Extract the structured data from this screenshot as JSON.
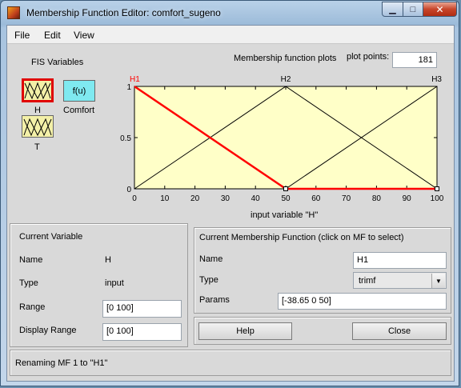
{
  "window": {
    "title": "Membership Function Editor: comfort_sugeno",
    "minimize_glyph": "▁",
    "maximize_glyph": "□",
    "close_glyph": "✕"
  },
  "menu": [
    "File",
    "Edit",
    "View"
  ],
  "fis_variables": {
    "title": "FIS Variables",
    "inputs": [
      {
        "name": "H",
        "selected": true
      },
      {
        "name": "T",
        "selected": false
      }
    ],
    "output": {
      "symbol": "f(u)",
      "name": "Comfort"
    }
  },
  "plot": {
    "title": "Membership function plots",
    "plot_points_label": "plot points:",
    "plot_points_value": "181",
    "xlabel": "input variable \"H\"",
    "chart_data": {
      "type": "line",
      "xlim": [
        0,
        100
      ],
      "ylim": [
        0,
        1
      ],
      "x_ticks": [
        "0",
        "10",
        "20",
        "30",
        "40",
        "50",
        "60",
        "70",
        "80",
        "90",
        "100"
      ],
      "y_ticks": [
        "0",
        "0.5",
        "1"
      ],
      "series": [
        {
          "name": "H1",
          "x": [
            0,
            50,
            100
          ],
          "y": [
            1,
            0,
            0
          ],
          "color": "#ff0000",
          "selected": true
        },
        {
          "name": "H2",
          "x": [
            0,
            50,
            100
          ],
          "y": [
            0,
            1,
            0
          ],
          "color": "#000000",
          "selected": false
        },
        {
          "name": "H3",
          "x": [
            0,
            50,
            100
          ],
          "y": [
            0,
            0,
            1
          ],
          "color": "#000000",
          "selected": false
        }
      ]
    }
  },
  "current_variable": {
    "title": "Current Variable",
    "name_label": "Name",
    "name_value": "H",
    "type_label": "Type",
    "type_value": "input",
    "range_label": "Range",
    "range_value": "[0 100]",
    "display_range_label": "Display Range",
    "display_range_value": "[0 100]"
  },
  "current_mf": {
    "title": "Current Membership Function (click on MF to select)",
    "name_label": "Name",
    "name_value": "H1",
    "type_label": "Type",
    "type_value": "trimf",
    "params_label": "Params",
    "params_value": "[-38.65 0 50]"
  },
  "buttons": {
    "help": "Help",
    "close": "Close"
  },
  "status": "Renaming MF 1 to \"H1\"",
  "colors": {
    "plot_background": "#ffffc8",
    "selected_mf": "#ff0000",
    "input_var": "#f3f0a8",
    "output_var": "#7fe9f0"
  }
}
